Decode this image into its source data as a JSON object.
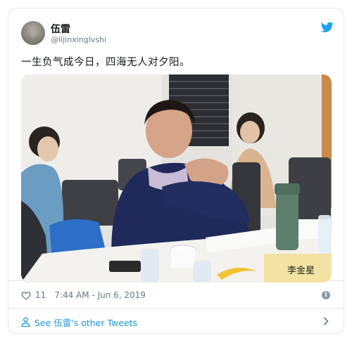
{
  "author": {
    "display_name": "伍雷",
    "handle": "@lijinxinglvshi"
  },
  "tweet": {
    "text": "一生负气成今日，四海无人对夕阳。",
    "likes": "11",
    "timestamp": "7:44 AM - Jun 6, 2019"
  },
  "photo": {
    "nameplate_text": "李金星"
  },
  "footer": {
    "see_more_label": "See 伍雷's other Tweets"
  },
  "icons": {
    "brand": "twitter-bird-icon",
    "like": "heart-icon",
    "info": "info-icon",
    "profile": "person-icon",
    "navigate": "chevron-right-icon"
  },
  "colors": {
    "twitter_blue": "#1da1f2",
    "link_blue": "#1b95e0",
    "meta_gray": "#657786",
    "border": "#e1e8ed"
  }
}
